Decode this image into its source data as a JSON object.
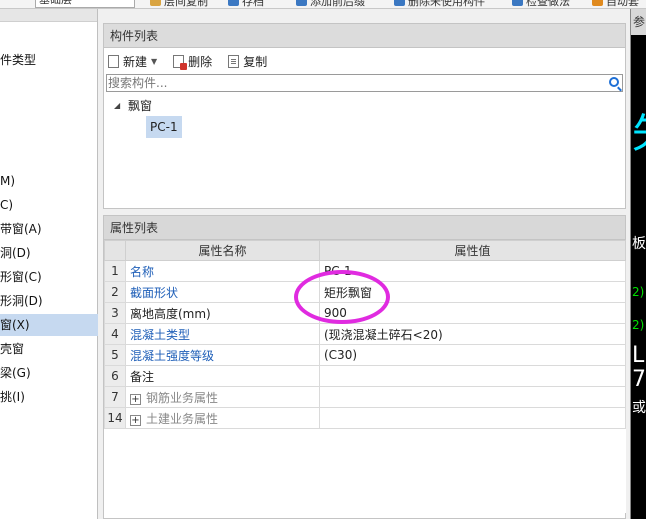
{
  "topbar": {
    "layer_combo": "基础层",
    "tools": [
      "层间复制",
      "存档",
      "添加前后缀",
      "删除未使用构件",
      "检查做法",
      "自动套"
    ]
  },
  "left_panel": {
    "items": [
      "件类型",
      "M)",
      "C)",
      "带窗(A)",
      "洞(D)",
      "形窗(C)",
      "形洞(D)",
      "窗(X)",
      "壳窗",
      "梁(G)",
      "挑(I)"
    ],
    "selected_index": 7
  },
  "component_list": {
    "title": "构件列表",
    "toolbar": {
      "new_label": "新建",
      "delete_label": "删除",
      "copy_label": "复制"
    },
    "search_placeholder": "搜索构件...",
    "tree": {
      "group_label": "飘窗",
      "items": [
        "PC-1"
      ]
    }
  },
  "property_list": {
    "title": "属性列表",
    "columns": [
      "属性名称",
      "属性值"
    ],
    "rows": [
      {
        "num": "1",
        "name": "名称",
        "value": "PC-1",
        "style": "blue"
      },
      {
        "num": "2",
        "name": "截面形状",
        "value": "矩形飘窗",
        "style": "blue"
      },
      {
        "num": "3",
        "name": "离地高度(mm)",
        "value": "900",
        "style": ""
      },
      {
        "num": "4",
        "name": "混凝土类型",
        "value": "(现浇混凝土碎石<20)",
        "style": "blue"
      },
      {
        "num": "5",
        "name": "混凝土强度等级",
        "value": "(C30)",
        "style": "blue"
      },
      {
        "num": "6",
        "name": "备注",
        "value": "",
        "style": ""
      },
      {
        "num": "7",
        "name": "钢筋业务属性",
        "value": "",
        "style": "grey",
        "expandable": true
      },
      {
        "num": "14",
        "name": "土建业务属性",
        "value": "",
        "style": "grey",
        "expandable": true
      }
    ]
  },
  "right_panel": {
    "header": "参",
    "texts": [
      "矢",
      "板",
      "2)",
      "2)",
      "L",
      "7",
      "或"
    ]
  },
  "colors": {
    "selection": "#c6d9f0",
    "link_blue": "#1f5fb8",
    "annotation_circle": "#e02be0",
    "cad_cyan": "#00e5ff",
    "cad_green": "#00e000"
  }
}
